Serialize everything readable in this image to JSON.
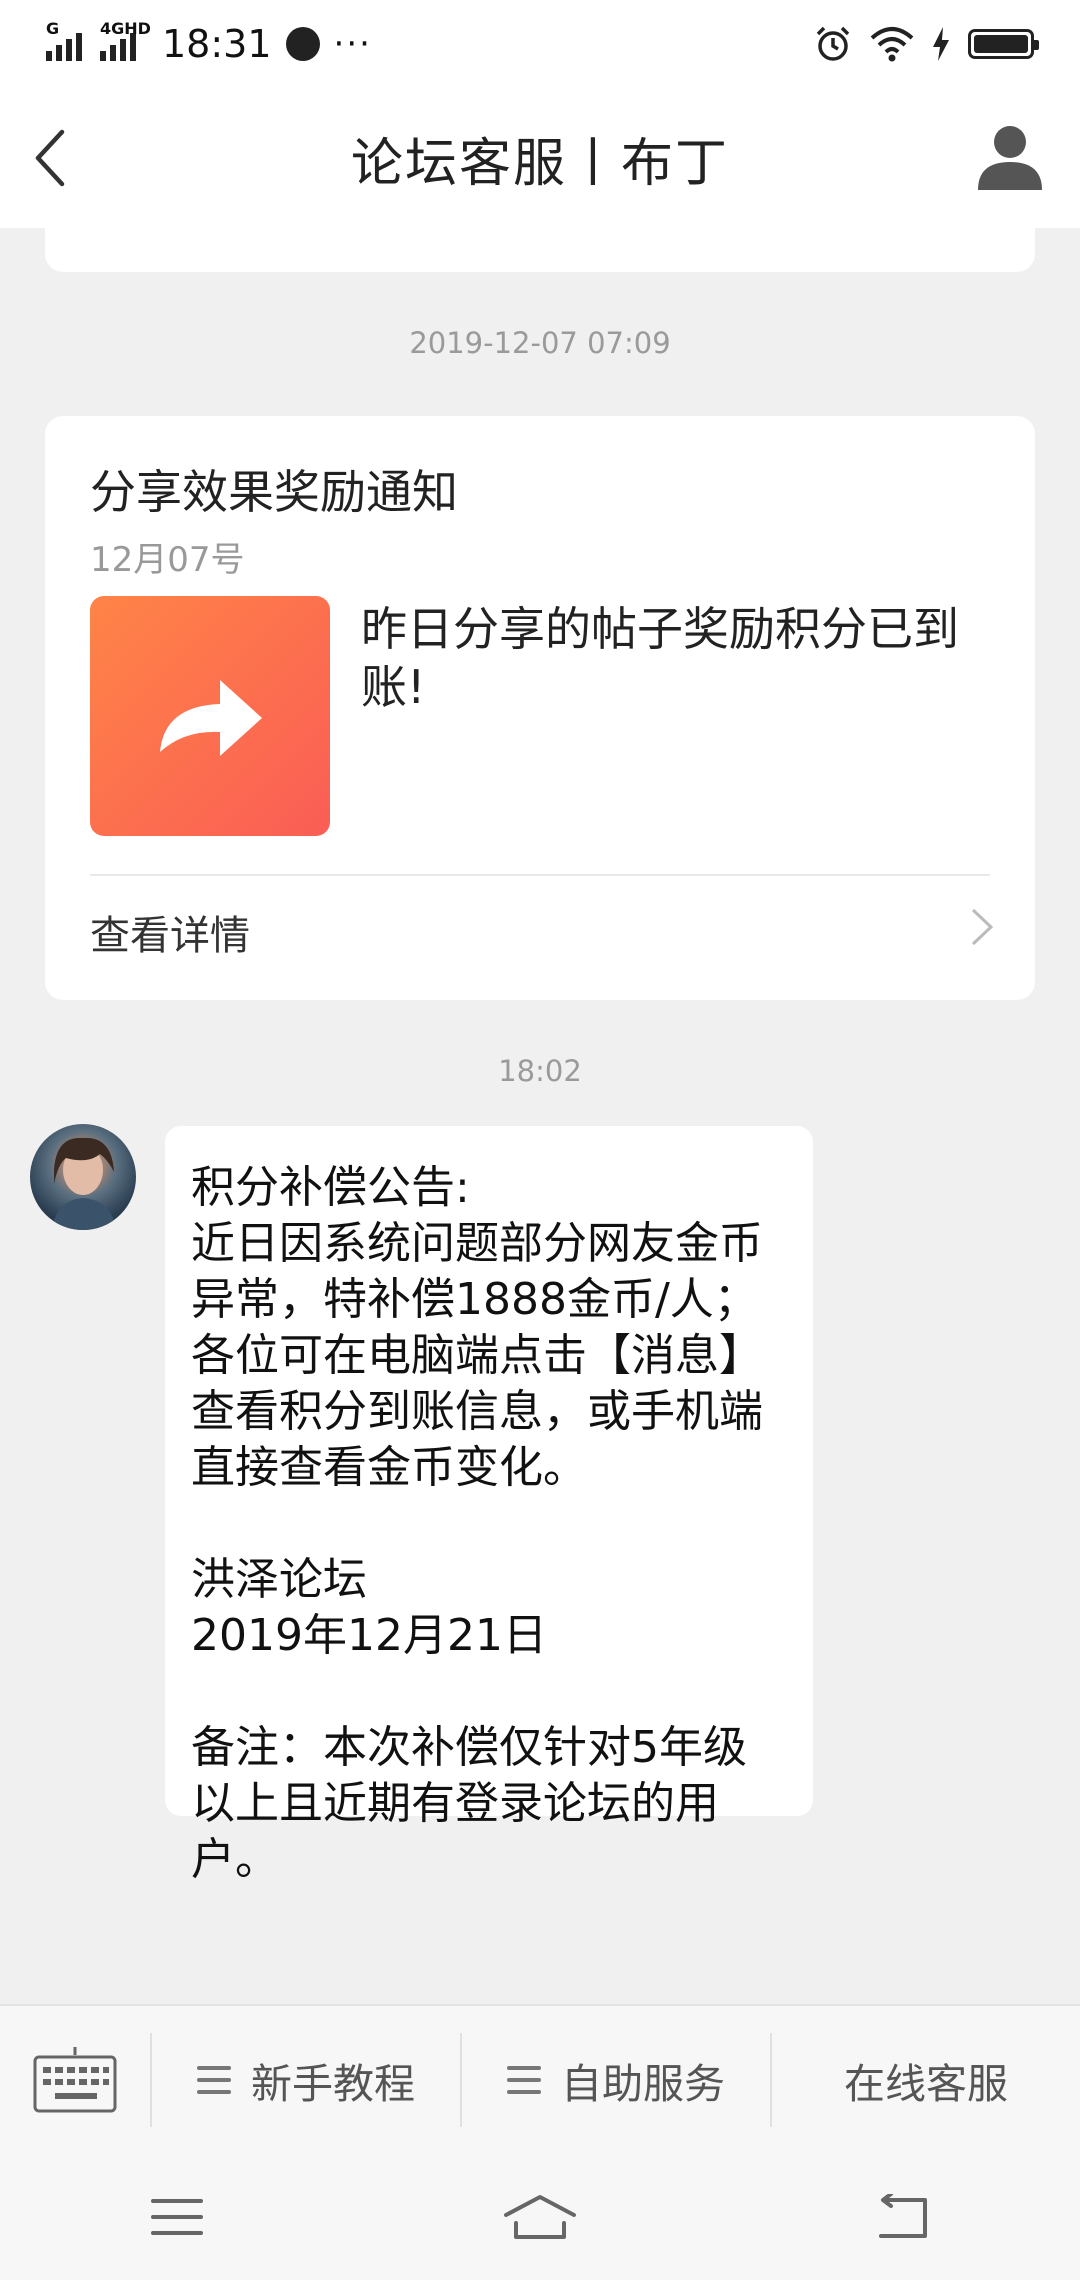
{
  "status_bar": {
    "network_1": "G",
    "network_2": "4GHD",
    "time": "18:31",
    "more": "···"
  },
  "header": {
    "title": "论坛客服丨布丁",
    "back_icon": "chevron-left-icon",
    "profile_icon": "person-icon"
  },
  "messages": {
    "timestamp_1": "2019-12-07 07:09",
    "card": {
      "title": "分享效果奖励通知",
      "date": "12月07号",
      "description": "昨日分享的帖子奖励积分已到账!",
      "detail_label": "查看详情",
      "thumb_icon": "share-arrow-icon",
      "thumb_color": "#fb6d4f"
    },
    "timestamp_2": "18:02",
    "bubble_text": "积分补偿公告:\n近日因系统问题部分网友金币异常，特补偿1888金币/人；各位可在电脑端点击【消息】查看积分到账信息，或手机端直接查看金币变化。\n\n洪泽论坛\n2019年12月21日\n\n备注：本次补偿仅针对5年级以上且近期有登录论坛的用户。"
  },
  "toolbar": {
    "keyboard_icon": "keyboard-icon",
    "items": [
      {
        "label": "新手教程",
        "icon": "menu-icon"
      },
      {
        "label": "自助服务",
        "icon": "menu-icon"
      },
      {
        "label": "在线客服"
      }
    ]
  },
  "system_nav": {
    "menu_icon": "menu-icon",
    "home_icon": "home-icon",
    "back_icon": "back-icon"
  }
}
